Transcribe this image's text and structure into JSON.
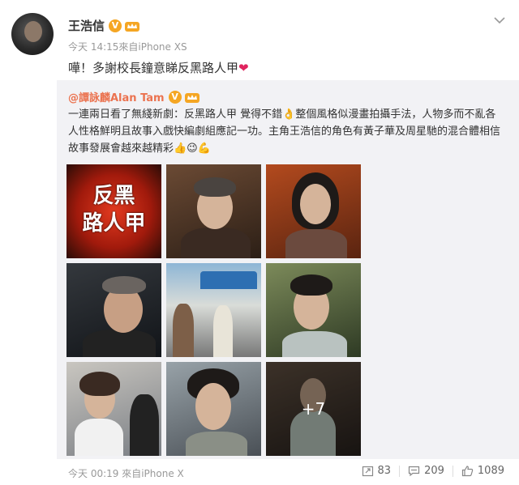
{
  "post": {
    "author": "王浩信",
    "meta": "今天 14:15來自iPhone XS",
    "text": "嘩！多謝校長鐘意睇反黑路人甲",
    "verified_label": "V"
  },
  "repost": {
    "author": "@譚詠麟Alan Tam",
    "verified_label": "V",
    "text": "一連兩日看了無綫新劇：反黑路人甲 覺得不錯👌整個風格似漫畫拍攝手法，人物多而不亂各人性格鮮明且故事入戲快編劇組應記一功。主角王浩信的角色有黃子華及周星馳的混合體相信故事發展會越來越精彩👍😉💪",
    "thumb1_title_line1": "反黑",
    "thumb1_title_line2": "路人甲",
    "more_photos": "+7"
  },
  "footer": {
    "meta": "今天 00:19 來自iPhone X",
    "repost_count": "83",
    "comment_count": "209",
    "like_count": "1089"
  },
  "colors": {
    "name_link": "#eb7350",
    "badge": "#f5a623",
    "muted": "#999999",
    "repost_bg": "#f2f2f5"
  }
}
